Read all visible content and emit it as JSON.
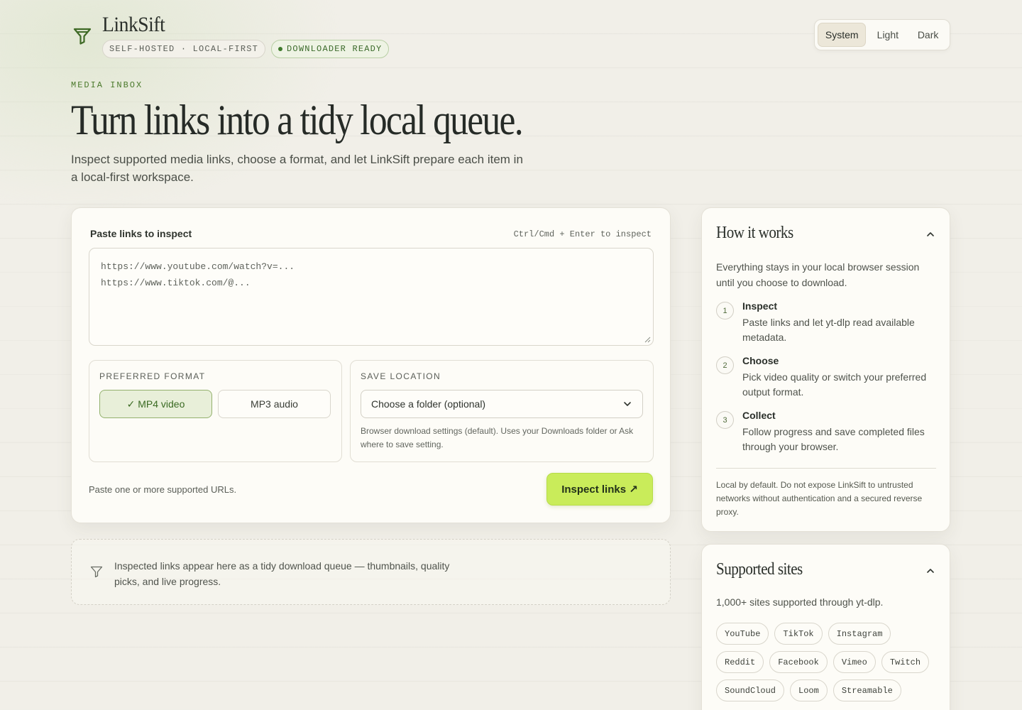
{
  "header": {
    "brand_name": "LinkSift",
    "badge_hosting": "SELF-HOSTED · LOCAL-FIRST",
    "badge_status": "DOWNLOADER READY",
    "theme_options": [
      "System",
      "Light",
      "Dark"
    ],
    "theme_selected": "System"
  },
  "hero": {
    "eyebrow": "MEDIA INBOX",
    "title": "Turn links into a tidy local queue.",
    "subtitle": "Inspect supported media links, choose a format, and let LinkSift prepare each item in a local-first workspace."
  },
  "input_card": {
    "label": "Paste links to inspect",
    "shortcut_hint": "Ctrl/Cmd + Enter to inspect",
    "textarea_placeholder": "https://www.youtube.com/watch?v=...\nhttps://www.tiktok.com/@...",
    "format": {
      "label": "PREFERRED FORMAT",
      "options": [
        "✓ MP4 video",
        "MP3 audio"
      ],
      "selected": "MP4 video"
    },
    "save": {
      "label": "SAVE LOCATION",
      "select_value": "Choose a folder (optional)",
      "note": "Browser download settings (default). Uses your Downloads folder or Ask where to save setting."
    },
    "footer_hint": "Paste one or more supported URLs.",
    "submit_label": "Inspect links ↗"
  },
  "queue": {
    "empty_text": "Inspected links appear here as a tidy download queue — thumbnails, quality picks, and live progress."
  },
  "how_it_works": {
    "title": "How it works",
    "intro": "Everything stays in your local browser session until you choose to download.",
    "steps": [
      {
        "num": "1",
        "title": "Inspect",
        "desc": "Paste links and let yt-dlp read available metadata."
      },
      {
        "num": "2",
        "title": "Choose",
        "desc": "Pick video quality or switch your preferred output format."
      },
      {
        "num": "3",
        "title": "Collect",
        "desc": "Follow progress and save completed files through your browser."
      }
    ],
    "note": "Local by default. Do not expose LinkSift to untrusted networks without authentication and a secured reverse proxy."
  },
  "supported_sites": {
    "title": "Supported sites",
    "intro": "1,000+ sites supported through yt-dlp.",
    "sites": [
      "YouTube",
      "TikTok",
      "Instagram",
      "Reddit",
      "Facebook",
      "Vimeo",
      "Twitch",
      "SoundCloud",
      "Loom",
      "Streamable"
    ]
  },
  "colors": {
    "accent": "#c9ec5a",
    "brand_green": "#3f7a2c",
    "background": "#f1efe8"
  },
  "icons": {
    "logo": "funnel-icon",
    "queue": "funnel-icon",
    "select": "chevron-down-icon",
    "collapse": "chevron-up-icon"
  }
}
